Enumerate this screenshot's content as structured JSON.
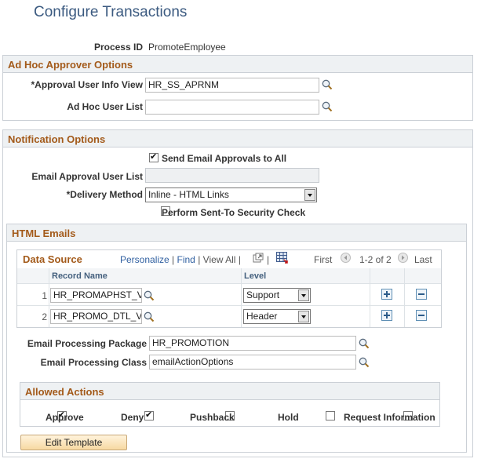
{
  "page": {
    "title": "Configure Transactions"
  },
  "process": {
    "label": "Process ID",
    "value": "PromoteEmployee"
  },
  "ad_hoc": {
    "header": "Ad Hoc Approver Options",
    "approval_view_label": "*Approval User Info View",
    "approval_view_value": "HR_SS_APRNM",
    "user_list_label": "Ad Hoc User List",
    "user_list_value": ""
  },
  "notification": {
    "header": "Notification Options",
    "send_all_label": "Send Email Approvals to All",
    "send_all_checked": true,
    "email_list_label": "Email Approval User List",
    "email_list_value": "",
    "delivery_label": "*Delivery Method",
    "delivery_value": "Inline - HTML Links",
    "security_label": "Perform Sent-To Security Check",
    "security_checked": false
  },
  "html_emails": {
    "header": "HTML Emails",
    "grid": {
      "title": "Data Source",
      "personalize": "Personalize",
      "sep": "|",
      "find": "Find",
      "view_all": "View All",
      "first": "First",
      "range": "1-2 of 2",
      "last": "Last",
      "columns": [
        "Record Name",
        "Level"
      ],
      "rows": [
        {
          "num": "1",
          "record": "HR_PROMAPHST_VW",
          "level": "Support"
        },
        {
          "num": "2",
          "record": "HR_PROMO_DTL_VW",
          "level": "Header"
        }
      ]
    },
    "package_label": "Email Processing Package",
    "package_value": "HR_PROMOTION",
    "class_label": "Email Processing Class",
    "class_value": "emailActionOptions",
    "allowed": {
      "header": "Allowed Actions",
      "items": [
        {
          "label": "Approve",
          "checked": true
        },
        {
          "label": "Deny",
          "checked": true
        },
        {
          "label": "Pushback",
          "checked": false
        },
        {
          "label": "Hold",
          "checked": false
        },
        {
          "label": "Request Information",
          "checked": false
        }
      ]
    },
    "edit_template": "Edit Template"
  }
}
